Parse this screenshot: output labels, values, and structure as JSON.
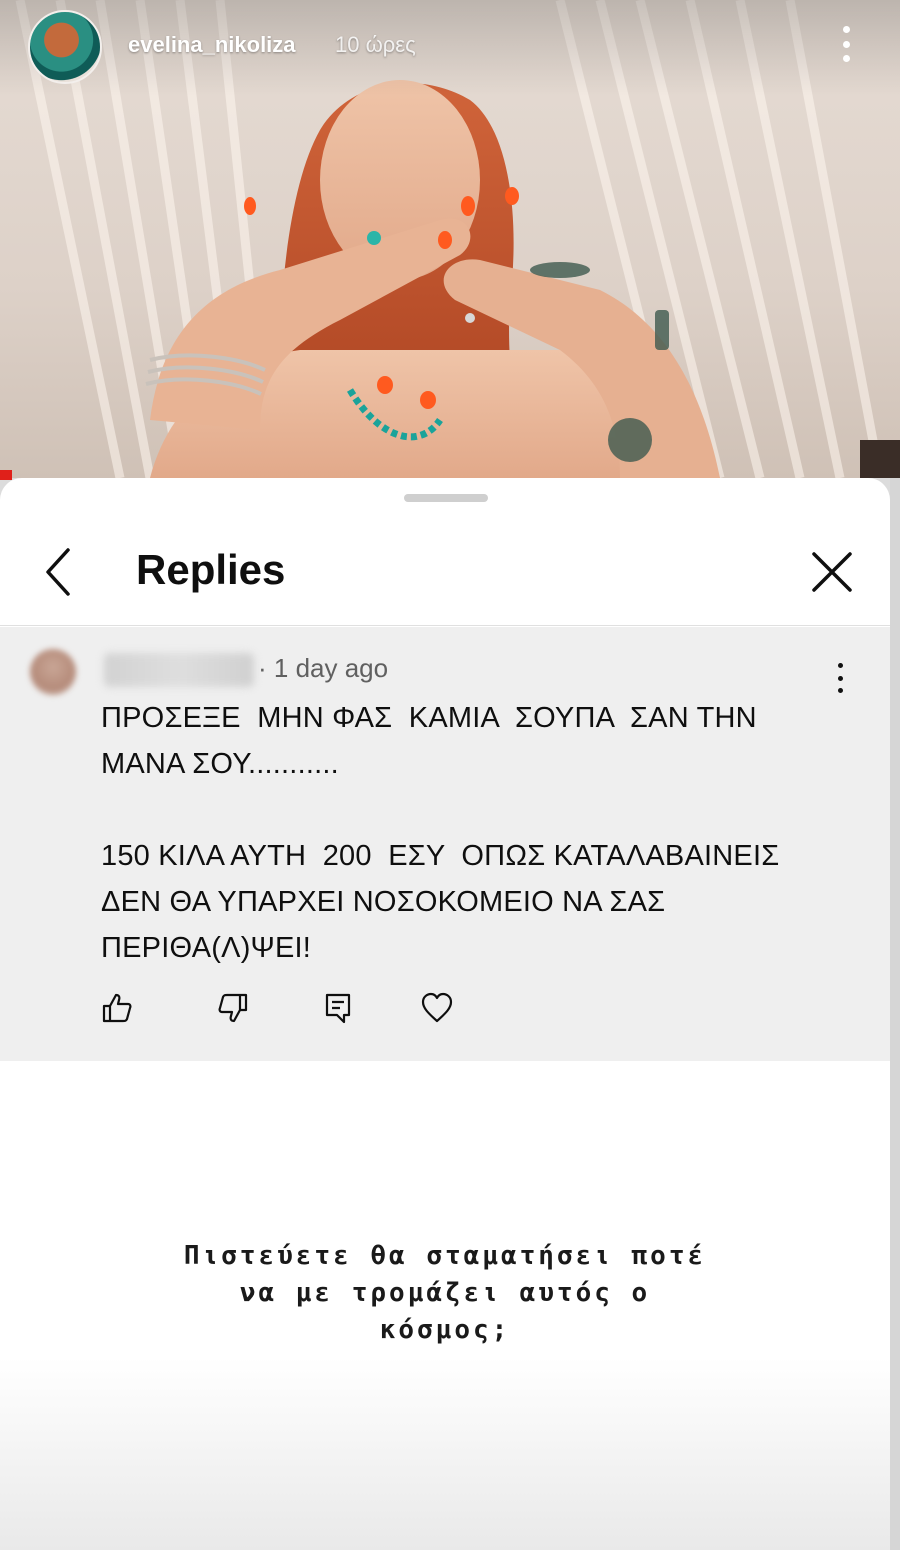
{
  "story": {
    "username": "evelina_nikoliza",
    "time": "10 ώρες",
    "more_icon": "vertical-ellipsis-icon"
  },
  "replies_panel": {
    "title": "Replies",
    "back_icon": "chevron-left-icon",
    "close_icon": "close-icon"
  },
  "comment": {
    "time": "· 1 day ago",
    "text": "ΠΡΟΣΕΞΕ  ΜΗΝ ΦΑΣ  ΚΑΜΙΑ  ΣΟΥΠΑ  ΣΑΝ ΤΗΝ\nΜΑΝΑ ΣΟΥ...........\n\n150 ΚΙΛΑ ΑΥΤΗ  200  ΕΣΥ  ΟΠΩΣ ΚΑΤΑΛΑΒΑΙΝΕΙΣ\nΔΕΝ ΘΑ ΥΠΑΡΧΕΙ ΝΟΣΟΚΟΜΕΙΟ ΝΑ ΣΑΣ\nΠΕΡΙΘΑ(Λ)ΨΕΙ!",
    "actions": [
      "thumbs-up-icon",
      "thumbs-down-icon",
      "reply-comment-icon",
      "heart-icon"
    ]
  },
  "caption": "Πιστεύετε θα σταματήσει ποτέ\nνα με τρομάζει αυτός ο\nκόσμος;",
  "colors": {
    "hair": "#c7562f",
    "nails": "#ff5a1f",
    "comment_bg": "#efefef",
    "accent_red": "#e0201a"
  }
}
